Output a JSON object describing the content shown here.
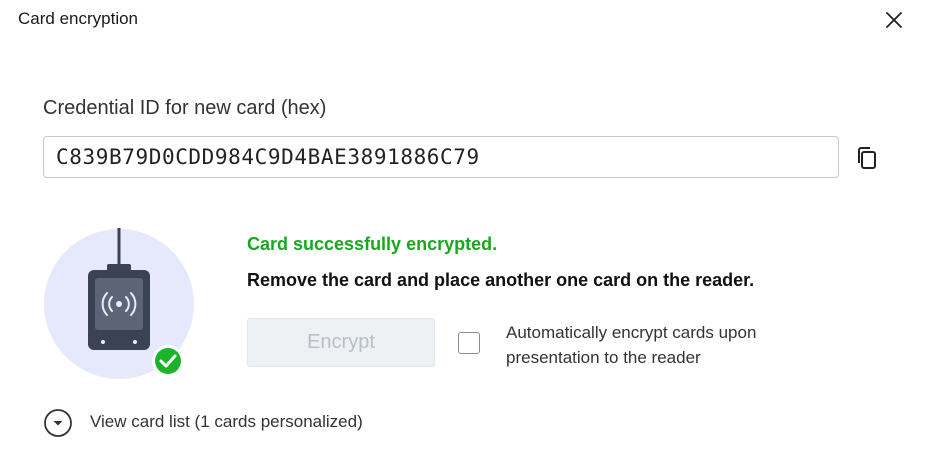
{
  "dialog": {
    "title": "Card encryption",
    "close_icon": "close-icon"
  },
  "credential": {
    "label": "Credential ID for new card (hex)",
    "value": "C839B79D0CDD984C9D4BAE3891886C79",
    "copy_icon": "copy-icon"
  },
  "illustration": {
    "reader_icon": "card-reader-icon",
    "success_icon": "check-circle-icon",
    "accent_color": "#1bb32a"
  },
  "status": {
    "success_text": "Card successfully encrypted.",
    "success_color": "#18a81f",
    "instruction_text": "Remove the card and place another one card on the reader."
  },
  "actions": {
    "encrypt_label": "Encrypt",
    "encrypt_disabled": true
  },
  "auto_encrypt": {
    "label": "Automatically encrypt cards upon presentation to the reader",
    "checked": false
  },
  "card_list": {
    "toggle_icon": "chevron-down-circle-icon",
    "label": "View card list (1 cards personalized)"
  }
}
